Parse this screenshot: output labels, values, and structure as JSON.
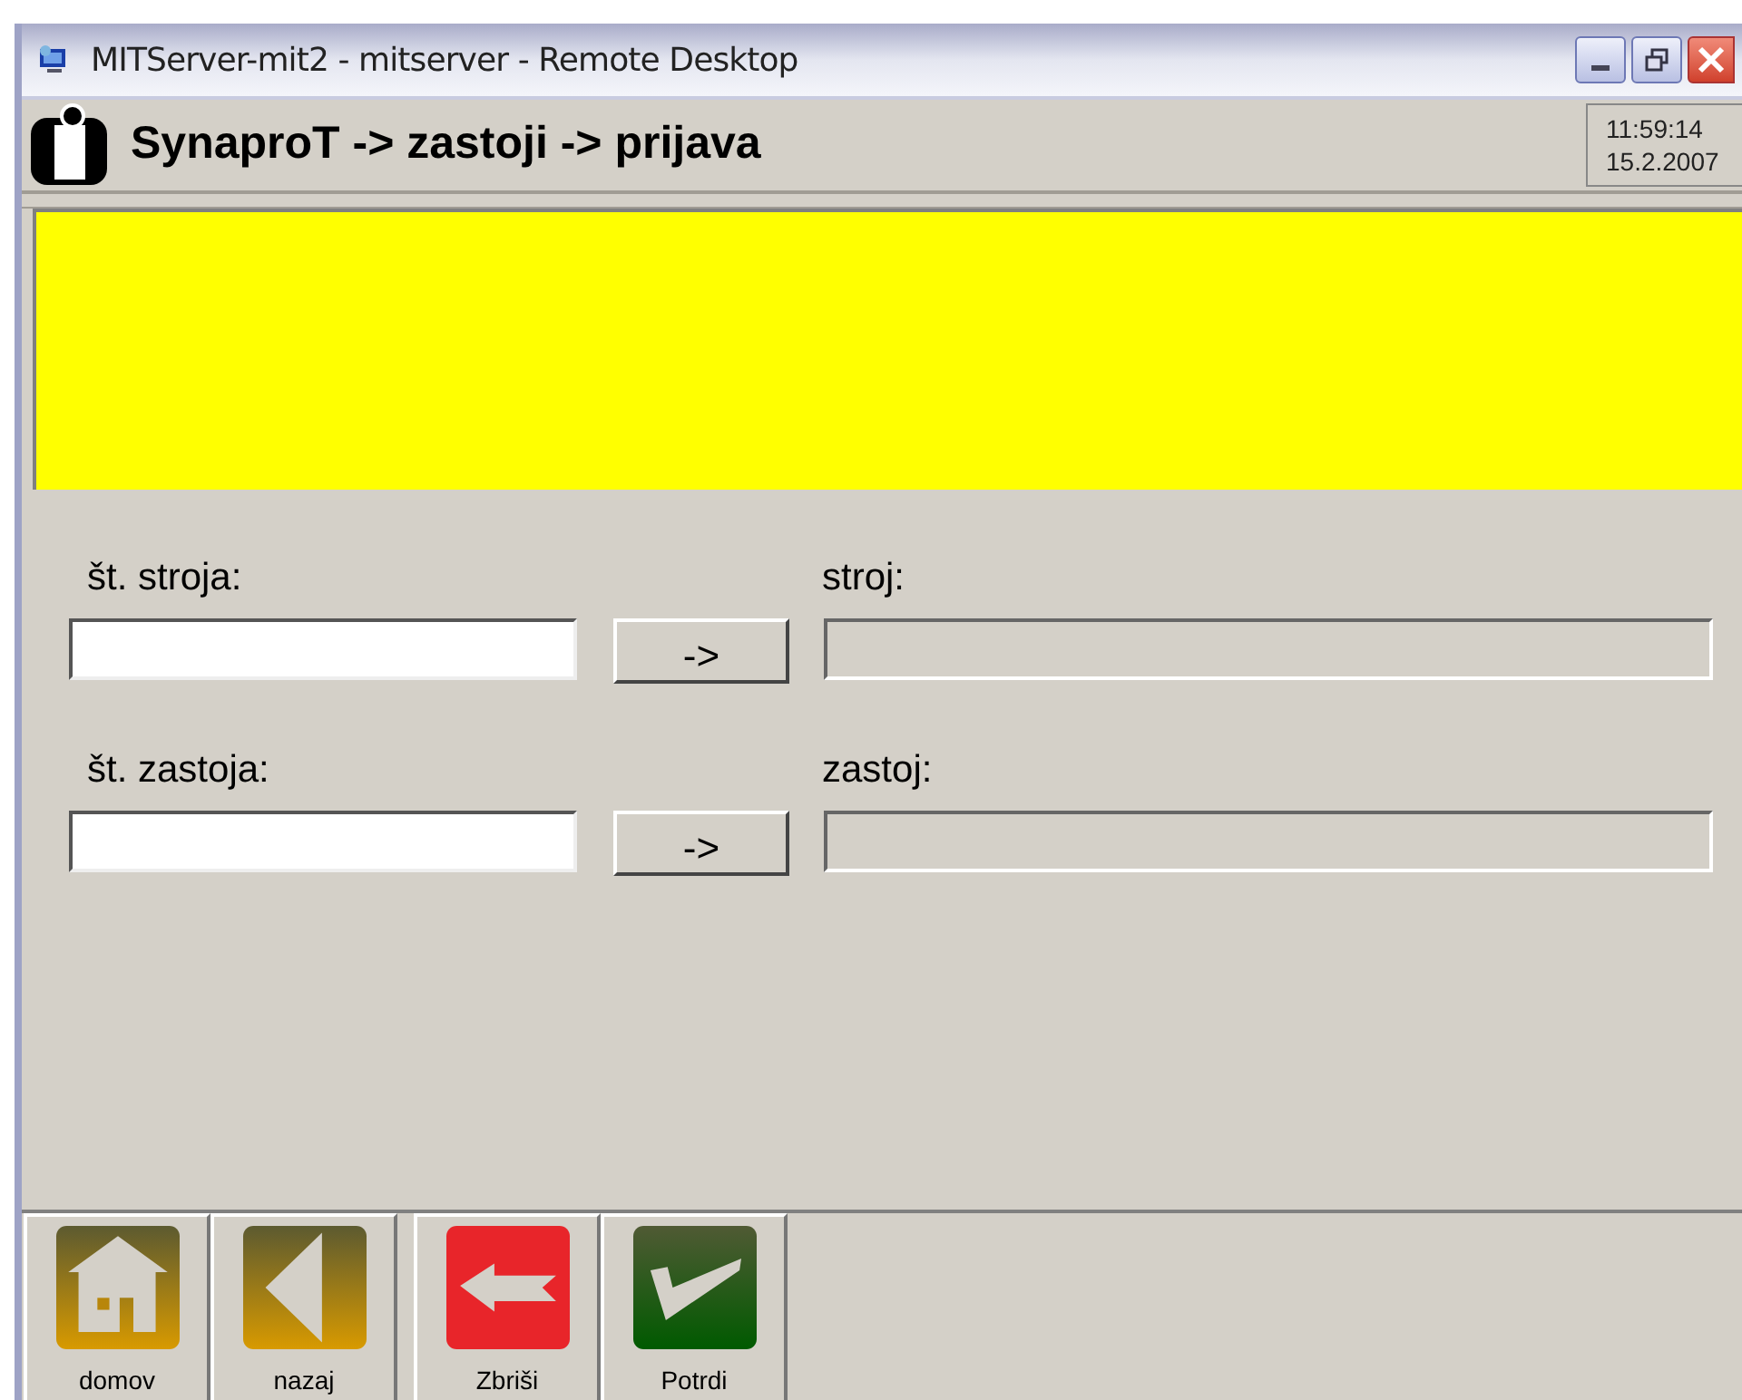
{
  "window": {
    "title": "MITServer-mit2 - mitserver - Remote Desktop"
  },
  "header": {
    "title": "SynaproT -> zastoji -> prijava",
    "time": "11:59:14",
    "date": "15.2.2007"
  },
  "form": [
    {
      "label": "št. stroja:",
      "button": "->",
      "result_label": "stroj:"
    },
    {
      "label": "št. zastoja:",
      "button": "->",
      "result_label": "zastoj:"
    }
  ],
  "toolbar": [
    {
      "kind": "home",
      "label": "domov"
    },
    {
      "kind": "back",
      "label": "nazaj"
    },
    {
      "kind": "delete",
      "label": "Zbriši"
    },
    {
      "kind": "confirm",
      "label": "Potrdi"
    }
  ]
}
